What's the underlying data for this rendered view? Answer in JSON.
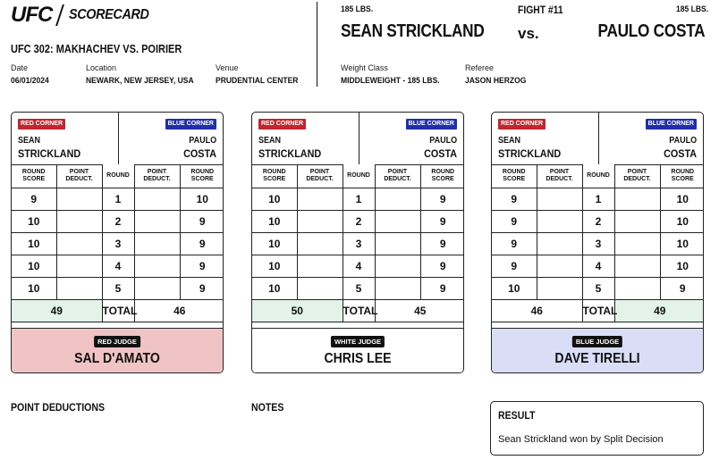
{
  "header": {
    "brand": "UFC",
    "doc_title": "SCORECARD",
    "event": "UFC 302: MAKHACHEV VS. POIRIER",
    "date_label": "Date",
    "date": "06/01/2024",
    "location_label": "Location",
    "location": "NEWARK, NEW JERSEY, USA",
    "venue_label": "Venue",
    "venue": "PRUDENTIAL CENTER",
    "fight_no": "FIGHT #11",
    "red_weight": "185 LBS.",
    "blue_weight": "185 LBS.",
    "red_fighter": "SEAN STRICKLAND",
    "blue_fighter": "PAULO COSTA",
    "vs": "vs.",
    "weight_class_label": "Weight Class",
    "weight_class": "MIDDLEWEIGHT - 185 LBS.",
    "referee_label": "Referee",
    "referee": "JASON HERZOG"
  },
  "labels": {
    "red_corner": "RED CORNER",
    "blue_corner": "BLUE CORNER",
    "round_score": "ROUND SCORE",
    "point_deduct": "POINT DEDUCT.",
    "round": "ROUND",
    "total": "TOTAL",
    "point_deductions": "POINT DEDUCTIONS",
    "notes": "NOTES",
    "result": "RESULT"
  },
  "fighters": {
    "red_first": "SEAN",
    "red_last": "STRICKLAND",
    "blue_first": "PAULO",
    "blue_last": "COSTA"
  },
  "cards": [
    {
      "judge_badge": "RED JUDGE",
      "judge_name": "SAL D'AMATO",
      "judge_bg": "#f0c4c4",
      "red_scores": [
        "9",
        "10",
        "10",
        "10",
        "10"
      ],
      "blue_scores": [
        "10",
        "9",
        "9",
        "9",
        "9"
      ],
      "rounds": [
        "1",
        "2",
        "3",
        "4",
        "5"
      ],
      "red_total": "49",
      "blue_total": "46",
      "winner": "red"
    },
    {
      "judge_badge": "WHITE JUDGE",
      "judge_name": "CHRIS LEE",
      "judge_bg": "#ffffff",
      "red_scores": [
        "10",
        "10",
        "10",
        "10",
        "10"
      ],
      "blue_scores": [
        "9",
        "9",
        "9",
        "9",
        "9"
      ],
      "rounds": [
        "1",
        "2",
        "3",
        "4",
        "5"
      ],
      "red_total": "50",
      "blue_total": "45",
      "winner": "red"
    },
    {
      "judge_badge": "BLUE JUDGE",
      "judge_name": "DAVE TIRELLI",
      "judge_bg": "#d9def6",
      "red_scores": [
        "9",
        "9",
        "9",
        "9",
        "10"
      ],
      "blue_scores": [
        "10",
        "10",
        "10",
        "10",
        "9"
      ],
      "rounds": [
        "1",
        "2",
        "3",
        "4",
        "5"
      ],
      "red_total": "46",
      "blue_total": "49",
      "winner": "blue"
    }
  ],
  "result": {
    "text": "Sean Strickland won by Split Decision"
  },
  "colors": {
    "red_corner": "#c0272d",
    "blue_corner": "#1f2fa8",
    "win_cell": "#e3f3ea"
  }
}
